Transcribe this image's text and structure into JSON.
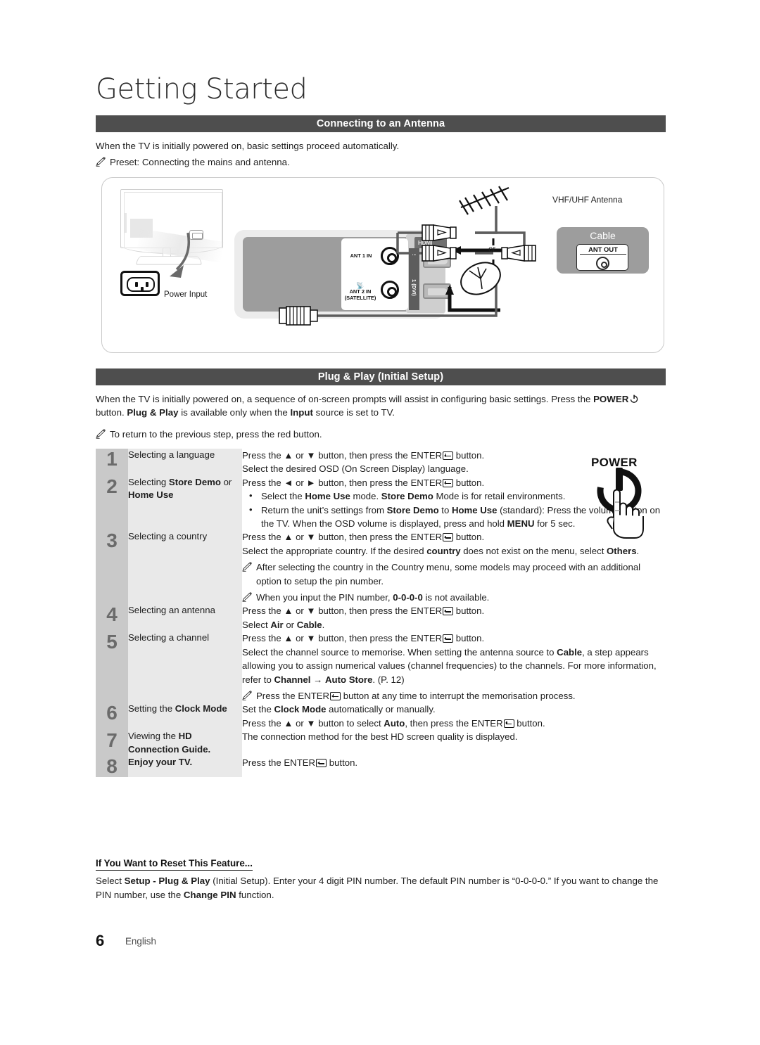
{
  "page": {
    "title": "Getting Started",
    "number": "6",
    "language": "English"
  },
  "sections": {
    "antenna": {
      "heading": "Connecting to an Antenna",
      "intro": "When the TV is initially powered on, basic settings proceed automatically.",
      "note": "Preset: Connecting the mains and antenna."
    },
    "plugplay": {
      "heading": "Plug & Play (Initial Setup)",
      "intro_1": "When the TV is initially powered on, a sequence of on-screen prompts will assist in configuring basic settings. Press the ",
      "intro_power": "POWER",
      "intro_2": " button. ",
      "intro_pp": "Plug & Play",
      "intro_3": " is available only when the ",
      "intro_input": "Input",
      "intro_4": " source is set to TV.",
      "note": "To return to the previous step, press the red button."
    }
  },
  "diagram": {
    "power_input_label": "Power Input",
    "ant1_label": "ANT 1 IN",
    "ant2_label_line1": "ANT 2 IN",
    "ant2_label_line2": "(SATELLITE)",
    "hdmi_label": "HDMI",
    "hdmi_port_2": "2",
    "hdmi_port_1": "1 (DVI)",
    "vhf_label": "VHF/UHF Antenna",
    "or_label": "or",
    "cable_label": "Cable",
    "ant_out_label": "ANT OUT"
  },
  "power_graphic": {
    "label": "POWER"
  },
  "steps": [
    {
      "number": "1",
      "label_plain": "Selecting a language",
      "lines": [
        "Press the ▲ or ▼ button, then press the ENTER button.",
        "Select the desired OSD (On Screen Display) language."
      ]
    },
    {
      "number": "2",
      "label_pre": "Selecting ",
      "label_bold": "Store Demo",
      "label_post": " or ",
      "label_bold2": "Home Use",
      "lead": "Press the ◄ or ► button, then press the ENTER button.",
      "bullets": [
        "Select the Home Use mode. Store Demo Mode is for retail environments.",
        "Return the unit's settings from Store Demo to Home Use (standard): Press the volume button on the TV. When the OSD volume is displayed, press and hold MENU for 5 sec."
      ]
    },
    {
      "number": "3",
      "label_plain": "Selecting a country",
      "lead": "Press the ▲ or ▼ button, then press the ENTER button.",
      "body": "Select the appropriate country. If the desired country does not exist on the menu, select Others.",
      "notes": [
        "After selecting the country in the Country menu, some models may proceed with an additional option to setup the pin number.",
        "When you input the PIN number, 0-0-0-0 is not available."
      ]
    },
    {
      "number": "4",
      "label_plain": "Selecting an antenna",
      "lines": [
        "Press the ▲ or ▼ button, then press the ENTER button.",
        "Select Air or Cable."
      ]
    },
    {
      "number": "5",
      "label_plain": "Selecting a channel",
      "lead": "Press the ▲ or ▼ button, then press the ENTER button.",
      "body": "Select the channel source to memorise. When setting the antenna source to Cable, a step appears allowing you to assign numerical values (channel frequencies) to the channels. For more information, refer to Channel → Auto Store. (P. 12)",
      "notes": [
        "Press the ENTER button at any time to interrupt the memorisation process."
      ]
    },
    {
      "number": "6",
      "label_pre": "Setting the ",
      "label_bold": "Clock Mode",
      "lines": [
        "Set the Clock Mode automatically or manually.",
        "Press the ▲ or ▼ button to select Auto, then press the ENTER button."
      ]
    },
    {
      "number": "7",
      "label_pre": "Viewing the ",
      "label_bold": "HD Connection Guide.",
      "lines": [
        "The connection method for the best HD screen quality is displayed."
      ]
    },
    {
      "number": "8",
      "label_bold_only": "Enjoy your TV.",
      "lines": [
        "Press the ENTER button."
      ]
    }
  ],
  "reset": {
    "heading": "If You Want to Reset This Feature...",
    "body_1": "Select ",
    "body_bold_1": "Setup - Plug & Play",
    "body_2": " (Initial Setup). Enter your 4 digit PIN number. The default PIN number is “0-0-0-0.” If you want to change the PIN number, use the ",
    "body_bold_2": "Change PIN",
    "body_3": " function."
  },
  "colors": {
    "header_bar": "#4e4e4e",
    "step_number_cell": "#c9c9c9",
    "step_label_cell": "#e9e9e9",
    "cable_box": "#9d9d9d"
  }
}
